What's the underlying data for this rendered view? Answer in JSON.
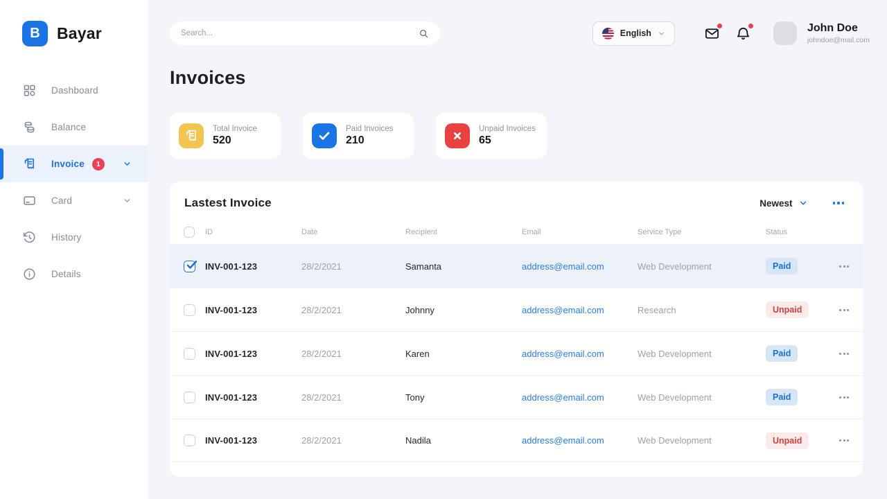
{
  "brand": {
    "name": "Bayar",
    "logo_letter": "B"
  },
  "sidebar": {
    "items": [
      {
        "label": "Dashboard",
        "icon": "dashboard-icon",
        "active": false
      },
      {
        "label": "Balance",
        "icon": "coins-icon",
        "active": false
      },
      {
        "label": "Invoice",
        "icon": "invoice-icon",
        "active": true,
        "badge": "1",
        "chevron": true
      },
      {
        "label": "Card",
        "icon": "card-icon",
        "active": false,
        "chevron": true
      },
      {
        "label": "History",
        "icon": "history-icon",
        "active": false
      },
      {
        "label": "Details",
        "icon": "info-icon",
        "active": false
      }
    ]
  },
  "topbar": {
    "search_placeholder": "Search...",
    "language": {
      "label": "English"
    },
    "user": {
      "name": "John Doe",
      "email": "johndoe@mail.com"
    },
    "notifications": {
      "mail_unread": true,
      "bell_unread": true
    }
  },
  "page": {
    "title": "Invoices"
  },
  "stats": [
    {
      "label": "Total Invoice",
      "value": "520",
      "icon": "invoice-icon",
      "color": "#f1c550"
    },
    {
      "label": "Paid Invoices",
      "value": "210",
      "icon": "check-icon",
      "color": "#1b74e4"
    },
    {
      "label": "Unpaid Invoices",
      "value": "65",
      "icon": "x-icon",
      "color": "#ea4141"
    }
  ],
  "invoice_table": {
    "title": "Lastest Invoice",
    "sort_label": "Newest",
    "columns": [
      "ID",
      "Date",
      "Recipient",
      "Email",
      "Service Type",
      "Status"
    ],
    "rows": [
      {
        "id": "INV-001-123",
        "date": "28/2/2021",
        "recipient": "Samanta",
        "email": "address@email.com",
        "service_type": "Web Development",
        "status": "Paid",
        "selected": true
      },
      {
        "id": "INV-001-123",
        "date": "28/2/2021",
        "recipient": "Johnny",
        "email": "address@email.com",
        "service_type": "Research",
        "status": "Unpaid",
        "selected": false
      },
      {
        "id": "INV-001-123",
        "date": "28/2/2021",
        "recipient": "Karen",
        "email": "address@email.com",
        "service_type": "Web Development",
        "status": "Paid",
        "selected": false
      },
      {
        "id": "INV-001-123",
        "date": "28/2/2021",
        "recipient": "Tony",
        "email": "address@email.com",
        "service_type": "Web Development",
        "status": "Paid",
        "selected": false
      },
      {
        "id": "INV-001-123",
        "date": "28/2/2021",
        "recipient": "Nadila",
        "email": "address@email.com",
        "service_type": "Web Development",
        "status": "Unpaid",
        "selected": false
      }
    ]
  },
  "colors": {
    "primary_blue": "#1b74e4",
    "badge_red": "#e94256",
    "stat_yellow": "#f1c550",
    "stat_red": "#ea4141",
    "paid_text": "#1a6fd6",
    "paid_bg": "#d7e6f7",
    "unpaid_text": "#cf4040",
    "unpaid_bg": "#fbeaea",
    "page_bg": "#f4f5fb"
  }
}
